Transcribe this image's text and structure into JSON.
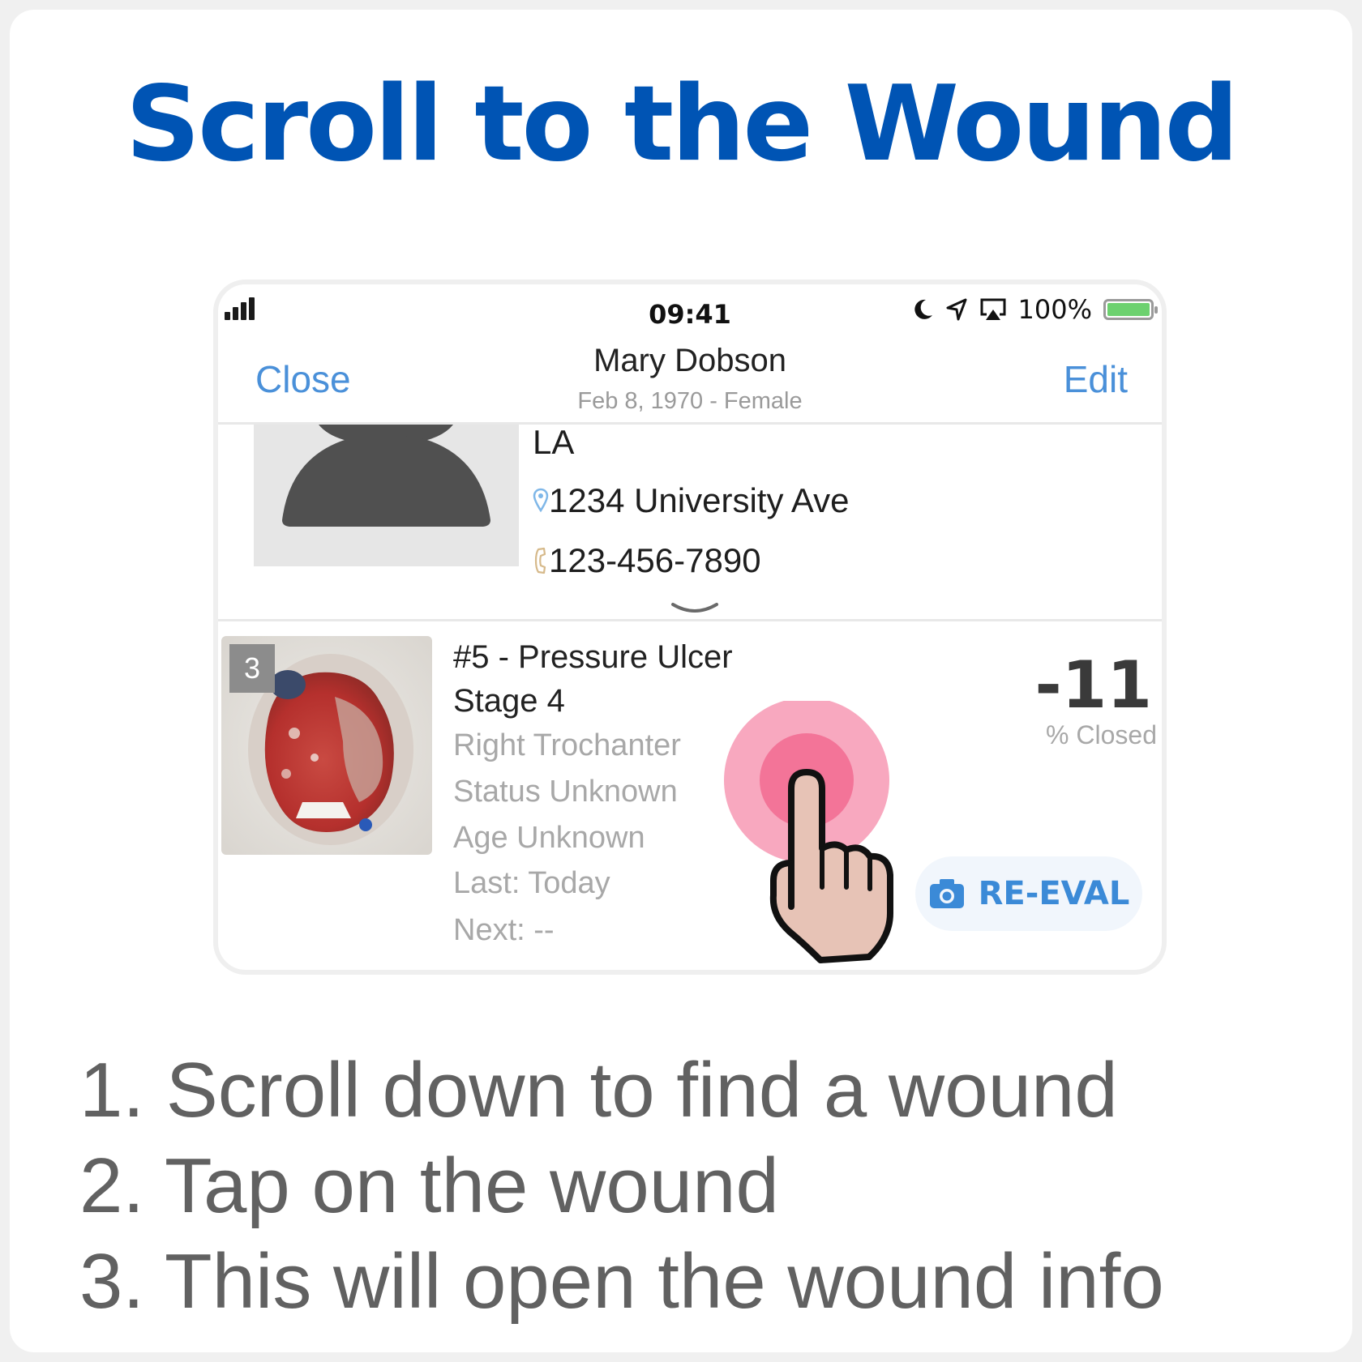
{
  "tutorial": {
    "title": "Scroll to the Wound",
    "steps": [
      "1. Scroll down to find a wound",
      "2. Tap on the wound",
      "3. This will open the wound info"
    ]
  },
  "status_bar": {
    "time": "09:41",
    "battery": "100%",
    "icons": [
      "signal-icon",
      "moon-icon",
      "location-icon",
      "airplay-icon",
      "battery-icon"
    ]
  },
  "nav": {
    "close_label": "Close",
    "edit_label": "Edit",
    "patient_name": "Mary Dobson",
    "patient_sub": "Feb 8, 1970 - Female"
  },
  "patient": {
    "location": "LA",
    "address": "1234 University Ave",
    "phone": "123-456-7890"
  },
  "wound": {
    "badge": "3",
    "title_line1": "#5 - Pressure Ulcer",
    "title_line2": "Stage 4",
    "site": "Right Trochanter",
    "status": "Status Unknown",
    "age": "Age Unknown",
    "last": "Last: Today",
    "next": "Next: --",
    "percent_value": "-11",
    "percent_label": "% Closed",
    "reeval_label": "RE-EVAL"
  },
  "colors": {
    "title_blue": "#0054b4",
    "link_blue": "#4a90d9",
    "tap_pink": "#f8a8bf",
    "battery_green": "#6cd16f"
  }
}
